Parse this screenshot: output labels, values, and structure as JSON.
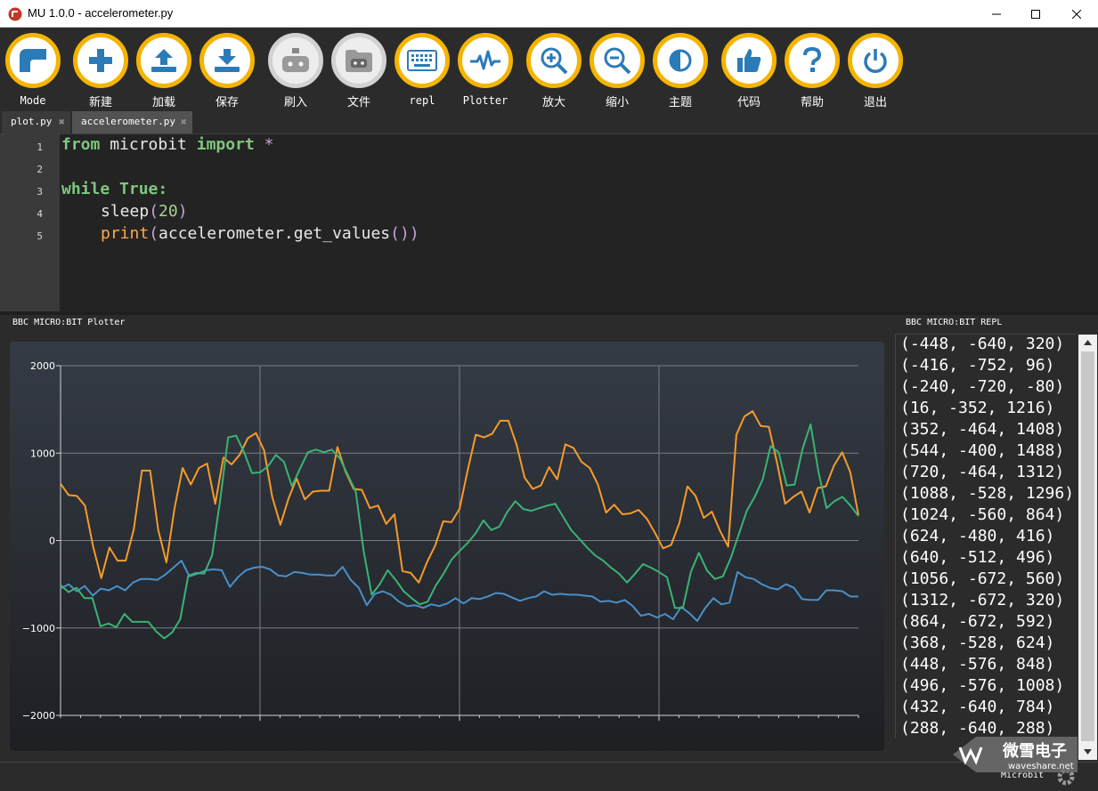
{
  "window": {
    "title": "MU 1.0.0 - accelerometer.py"
  },
  "toolbar": {
    "buttons": [
      {
        "label": "Mode",
        "icon": "mode-icon"
      },
      {
        "label": "新建",
        "icon": "plus-icon"
      },
      {
        "label": "加载",
        "icon": "upload-icon"
      },
      {
        "label": "保存",
        "icon": "download-icon"
      },
      {
        "label": "刷入",
        "icon": "microbit-flash-icon"
      },
      {
        "label": "文件",
        "icon": "microbit-files-icon"
      },
      {
        "label": "repl",
        "icon": "keyboard-icon"
      },
      {
        "label": "Plotter",
        "icon": "pulse-icon"
      },
      {
        "label": "放大",
        "icon": "zoom-in-icon"
      },
      {
        "label": "缩小",
        "icon": "zoom-out-icon"
      },
      {
        "label": "主题",
        "icon": "contrast-icon"
      },
      {
        "label": "代码",
        "icon": "thumbs-up-icon"
      },
      {
        "label": "帮助",
        "icon": "question-icon"
      },
      {
        "label": "退出",
        "icon": "power-icon"
      }
    ]
  },
  "tabs": [
    {
      "label": "plot.py"
    },
    {
      "label": "accelerometer.py"
    }
  ],
  "editor": {
    "line_numbers": [
      "1",
      "2",
      "3",
      "4",
      "5"
    ],
    "lines": {
      "l1": {
        "kw1": "from",
        "mod": " microbit ",
        "kw2": "import",
        "star": " *"
      },
      "l3": {
        "kw1": "while",
        "kw2": " True",
        "colon": ":"
      },
      "l4": {
        "fn": "sleep",
        "open": "(",
        "num": "20",
        "close": ")"
      },
      "l5": {
        "fn": "print",
        "open": "(",
        "body": "accelerometer.get_values",
        "inner": "()",
        "close": ")"
      }
    }
  },
  "plotter": {
    "title": "BBC MICRO:BIT Plotter"
  },
  "repl": {
    "title": "BBC MICRO:BIT REPL",
    "lines": [
      "(-448, -640, 320)",
      "(-416, -752, 96)",
      "(-240, -720, -80)",
      "(16, -352, 1216)",
      "(352, -464, 1408)",
      "(544, -400, 1488)",
      "(720, -464, 1312)",
      "(1088, -528, 1296)",
      "(1024, -560, 864)",
      "(624, -480, 416)",
      "(640, -512, 496)",
      "(1056, -672, 560)",
      "(1312, -672, 320)",
      "(864, -672, 592)",
      "(368, -528, 624)",
      "(448, -576, 848)",
      "(496, -576, 1008)",
      "(432, -640, 784)",
      "(288, -640, 288)"
    ]
  },
  "status": {
    "mode": "Microbit"
  },
  "watermark": {
    "brand": "微雪电子",
    "url": "waveshare.net"
  },
  "colors": {
    "accent": "#f5b400",
    "series_x": "#f59b2b",
    "series_y": "#4a8fc7",
    "series_z": "#3bb374"
  },
  "chart_data": {
    "type": "line",
    "title": "",
    "xlabel": "",
    "ylabel": "",
    "ylim": [
      -2000,
      2000
    ],
    "yticks": [
      "2000",
      "1000",
      "0",
      "−1000",
      "−2000"
    ],
    "grid": true,
    "series": [
      {
        "color": "#f59b2b",
        "values": [
          650,
          520,
          510,
          400,
          -70,
          -430,
          -80,
          -230,
          -230,
          130,
          800,
          800,
          120,
          -250,
          370,
          830,
          640,
          830,
          880,
          420,
          950,
          870,
          980,
          1170,
          1230,
          1030,
          500,
          180,
          480,
          710,
          470,
          560,
          570,
          570,
          1070,
          790,
          590,
          580,
          370,
          400,
          190,
          300,
          -350,
          -370,
          -480,
          -250,
          -60,
          220,
          210,
          360,
          800,
          1210,
          1180,
          1220,
          1370,
          1370,
          1100,
          720,
          590,
          630,
          840,
          700,
          1100,
          1060,
          900,
          830,
          640,
          320,
          410,
          300,
          310,
          350,
          250,
          90,
          -90,
          -50,
          200,
          620,
          510,
          260,
          330,
          110,
          -70,
          1210,
          1420,
          1480,
          1310,
          1300,
          890,
          420,
          500,
          560,
          320,
          600,
          620,
          860,
          1010,
          780,
          290
        ]
      },
      {
        "color": "#4a8fc7",
        "values": [
          -550,
          -500,
          -580,
          -520,
          -630,
          -550,
          -570,
          -520,
          -570,
          -480,
          -440,
          -440,
          -450,
          -390,
          -310,
          -230,
          -410,
          -380,
          -340,
          -330,
          -340,
          -530,
          -420,
          -340,
          -310,
          -300,
          -330,
          -400,
          -410,
          -360,
          -370,
          -390,
          -390,
          -400,
          -400,
          -300,
          -450,
          -540,
          -740,
          -610,
          -580,
          -620,
          -700,
          -750,
          -740,
          -770,
          -730,
          -750,
          -720,
          -660,
          -720,
          -660,
          -670,
          -640,
          -600,
          -610,
          -650,
          -690,
          -660,
          -640,
          -580,
          -620,
          -610,
          -620,
          -620,
          -630,
          -640,
          -700,
          -690,
          -710,
          -680,
          -750,
          -860,
          -840,
          -880,
          -840,
          -900,
          -760,
          -830,
          -920,
          -770,
          -660,
          -730,
          -710,
          -360,
          -420,
          -440,
          -500,
          -540,
          -560,
          -500,
          -540,
          -670,
          -680,
          -680,
          -570,
          -570,
          -580,
          -640,
          -640
        ]
      },
      {
        "color": "#3bb374",
        "values": [
          -510,
          -590,
          -540,
          -660,
          -660,
          -980,
          -950,
          -990,
          -840,
          -930,
          -930,
          -930,
          -1040,
          -1120,
          -1050,
          -900,
          -400,
          -370,
          -380,
          -170,
          460,
          1180,
          1200,
          1010,
          770,
          780,
          850,
          980,
          900,
          620,
          820,
          1010,
          1040,
          1010,
          1040,
          940,
          750,
          560,
          -130,
          -620,
          -500,
          -340,
          -450,
          -580,
          -660,
          -730,
          -700,
          -520,
          -380,
          -220,
          -120,
          -30,
          80,
          230,
          120,
          160,
          330,
          450,
          360,
          340,
          370,
          400,
          420,
          270,
          120,
          20,
          -80,
          -170,
          -230,
          -310,
          -380,
          -480,
          -380,
          -270,
          -310,
          -360,
          -420,
          -770,
          -770,
          -360,
          -140,
          -340,
          -440,
          -410,
          -200,
          70,
          340,
          500,
          700,
          1080,
          1010,
          630,
          640,
          1050,
          1330,
          780,
          370,
          450,
          500,
          400,
          280
        ]
      }
    ]
  }
}
